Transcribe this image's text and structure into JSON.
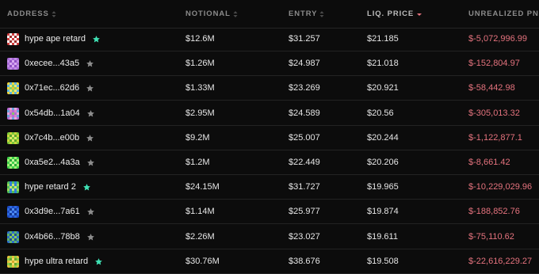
{
  "colors": {
    "background": "#0c0c0c",
    "header_text": "#8b8b8b",
    "text": "#e6e6e6",
    "pnl_negative": "#e5737e",
    "star_favorite": "#3fe0b3",
    "star_default": "#8c8c8c",
    "divider": "#232323",
    "sort_active": "#e5737e"
  },
  "columns": [
    {
      "key": "address",
      "label": "ADDRESS",
      "sort": "none"
    },
    {
      "key": "notional",
      "label": "NOTIONAL",
      "sort": "none"
    },
    {
      "key": "entry",
      "label": "ENTRY",
      "sort": "none"
    },
    {
      "key": "liq_price",
      "label": "LIQ. PRICE",
      "sort": "desc"
    },
    {
      "key": "unrealized_pnl",
      "label": "UNREALIZED PNL",
      "sort": "none"
    }
  ],
  "rows": [
    {
      "address": "hype ape retard",
      "star": "favorite",
      "notional": "$12.6M",
      "entry": "$31.257",
      "liq_price": "$21.185",
      "unrealized_pnl": "$-5,072,996.99",
      "avatar": [
        "#d23f3f",
        "#ffffff",
        "#d23f3f",
        "#ffffff",
        "#d23f3f",
        "#ffffff",
        "#9a2c2c",
        "#ffffff",
        "#9a2c2c",
        "#ffffff",
        "#d23f3f",
        "#ffffff",
        "#d23f3f",
        "#ffffff",
        "#d23f3f",
        "#ffffff",
        "#9a2c2c",
        "#ffffff",
        "#9a2c2c",
        "#ffffff",
        "#d23f3f",
        "#ffffff",
        "#d23f3f",
        "#ffffff",
        "#d23f3f"
      ]
    },
    {
      "address": "0xecee...43a5",
      "star": "default",
      "notional": "$1.26M",
      "entry": "$24.987",
      "liq_price": "$21.018",
      "unrealized_pnl": "$-152,804.97",
      "avatar": [
        "#a96ad8",
        "#c18be6",
        "#a96ad8",
        "#c18be6",
        "#a96ad8",
        "#c18be6",
        "#8f4fc4",
        "#d7a9f1",
        "#8f4fc4",
        "#c18be6",
        "#a96ad8",
        "#d7a9f1",
        "#a96ad8",
        "#d7a9f1",
        "#a96ad8",
        "#c18be6",
        "#8f4fc4",
        "#d7a9f1",
        "#8f4fc4",
        "#c18be6",
        "#a96ad8",
        "#c18be6",
        "#a96ad8",
        "#c18be6",
        "#a96ad8"
      ]
    },
    {
      "address": "0x71ec...62d6",
      "star": "default",
      "notional": "$1.33M",
      "entry": "$23.269",
      "liq_price": "$20.921",
      "unrealized_pnl": "$-58,442.98",
      "avatar": [
        "#f0d53c",
        "#5fb6e0",
        "#f0d53c",
        "#5fb6e0",
        "#f0d53c",
        "#5fb6e0",
        "#f6e676",
        "#7fd06a",
        "#f6e676",
        "#5fb6e0",
        "#f0d53c",
        "#7fd06a",
        "#e7c22c",
        "#7fd06a",
        "#f0d53c",
        "#5fb6e0",
        "#f6e676",
        "#7fd06a",
        "#f6e676",
        "#5fb6e0",
        "#f0d53c",
        "#5fb6e0",
        "#f0d53c",
        "#5fb6e0",
        "#f0d53c"
      ]
    },
    {
      "address": "0x54db...1a04",
      "star": "default",
      "notional": "$2.95M",
      "entry": "$24.589",
      "liq_price": "$20.56",
      "unrealized_pnl": "$-305,013.32",
      "avatar": [
        "#b86bd6",
        "#e8a4d9",
        "#6aa5dc",
        "#e8a4d9",
        "#b86bd6",
        "#6aa5dc",
        "#d985c8",
        "#b86bd6",
        "#d985c8",
        "#6aa5dc",
        "#e8a4d9",
        "#b86bd6",
        "#8ac26c",
        "#b86bd6",
        "#e8a4d9",
        "#6aa5dc",
        "#d985c8",
        "#b86bd6",
        "#d985c8",
        "#6aa5dc",
        "#b86bd6",
        "#e8a4d9",
        "#6aa5dc",
        "#e8a4d9",
        "#b86bd6"
      ]
    },
    {
      "address": "0x7c4b...e00b",
      "star": "default",
      "notional": "$9.2M",
      "entry": "$25.007",
      "liq_price": "$20.244",
      "unrealized_pnl": "$-1,122,877.1",
      "avatar": [
        "#7cc93a",
        "#c9d73c",
        "#7cc93a",
        "#c9d73c",
        "#7cc93a",
        "#c9d73c",
        "#5aa52c",
        "#e0e86a",
        "#5aa52c",
        "#c9d73c",
        "#7cc93a",
        "#e0e86a",
        "#7cc93a",
        "#e0e86a",
        "#7cc93a",
        "#c9d73c",
        "#5aa52c",
        "#e0e86a",
        "#5aa52c",
        "#c9d73c",
        "#7cc93a",
        "#c9d73c",
        "#7cc93a",
        "#c9d73c",
        "#7cc93a"
      ]
    },
    {
      "address": "0xa5e2...4a3a",
      "star": "default",
      "notional": "$1.2M",
      "entry": "$22.449",
      "liq_price": "$20.206",
      "unrealized_pnl": "$-8,661.42",
      "avatar": [
        "#3fd14c",
        "#9ef070",
        "#3fd14c",
        "#9ef070",
        "#3fd14c",
        "#9ef070",
        "#2aa83a",
        "#c5f79a",
        "#2aa83a",
        "#9ef070",
        "#3fd14c",
        "#c5f79a",
        "#3fd14c",
        "#c5f79a",
        "#3fd14c",
        "#9ef070",
        "#2aa83a",
        "#c5f79a",
        "#2aa83a",
        "#9ef070",
        "#3fd14c",
        "#9ef070",
        "#3fd14c",
        "#9ef070",
        "#3fd14c"
      ]
    },
    {
      "address": "hype retard 2",
      "star": "favorite",
      "notional": "$24.15M",
      "entry": "$31.727",
      "liq_price": "$19.965",
      "unrealized_pnl": "$-10,229,029.96",
      "avatar": [
        "#4fbf5a",
        "#2f7fd6",
        "#4fbf5a",
        "#2f7fd6",
        "#4fbf5a",
        "#9ad85a",
        "#2f7fd6",
        "#c8e27a",
        "#2f7fd6",
        "#9ad85a",
        "#4fbf5a",
        "#c8e27a",
        "#4fbf5a",
        "#c8e27a",
        "#4fbf5a",
        "#9ad85a",
        "#2f7fd6",
        "#c8e27a",
        "#2f7fd6",
        "#9ad85a",
        "#4fbf5a",
        "#2f7fd6",
        "#4fbf5a",
        "#2f7fd6",
        "#4fbf5a"
      ]
    },
    {
      "address": "0x3d9e...7a61",
      "star": "default",
      "notional": "$1.14M",
      "entry": "$25.977",
      "liq_price": "$19.874",
      "unrealized_pnl": "$-188,852.76",
      "avatar": [
        "#1d49c2",
        "#2c6ae0",
        "#1d49c2",
        "#2c6ae0",
        "#1d49c2",
        "#2c6ae0",
        "#13338f",
        "#4d8cf0",
        "#13338f",
        "#2c6ae0",
        "#1d49c2",
        "#4d8cf0",
        "#1d49c2",
        "#4d8cf0",
        "#1d49c2",
        "#2c6ae0",
        "#13338f",
        "#4d8cf0",
        "#13338f",
        "#2c6ae0",
        "#1d49c2",
        "#2c6ae0",
        "#1d49c2",
        "#2c6ae0",
        "#1d49c2"
      ]
    },
    {
      "address": "0x4b66...78b8",
      "star": "default",
      "notional": "$2.26M",
      "entry": "$23.027",
      "liq_price": "$19.611",
      "unrealized_pnl": "$-75,110.62",
      "avatar": [
        "#2e6fc9",
        "#5bb36b",
        "#2e6fc9",
        "#5bb36b",
        "#2e6fc9",
        "#5bb36b",
        "#1e4f99",
        "#88c95e",
        "#1e4f99",
        "#5bb36b",
        "#2e6fc9",
        "#88c95e",
        "#2e6fc9",
        "#88c95e",
        "#2e6fc9",
        "#5bb36b",
        "#1e4f99",
        "#88c95e",
        "#1e4f99",
        "#5bb36b",
        "#2e6fc9",
        "#5bb36b",
        "#2e6fc9",
        "#5bb36b",
        "#2e6fc9"
      ]
    },
    {
      "address": "hype ultra retard",
      "star": "favorite",
      "notional": "$30.76M",
      "entry": "$38.676",
      "liq_price": "$19.508",
      "unrealized_pnl": "$-22,616,229.27",
      "avatar": [
        "#e6c13a",
        "#8fcf4a",
        "#e6c13a",
        "#8fcf4a",
        "#e6c13a",
        "#8fcf4a",
        "#6aa52c",
        "#f0dc6a",
        "#6aa52c",
        "#8fcf4a",
        "#e6c13a",
        "#f0dc6a",
        "#d9a82c",
        "#f0dc6a",
        "#e6c13a",
        "#8fcf4a",
        "#6aa52c",
        "#f0dc6a",
        "#6aa52c",
        "#8fcf4a",
        "#e6c13a",
        "#8fcf4a",
        "#e6c13a",
        "#8fcf4a",
        "#e6c13a"
      ]
    }
  ]
}
